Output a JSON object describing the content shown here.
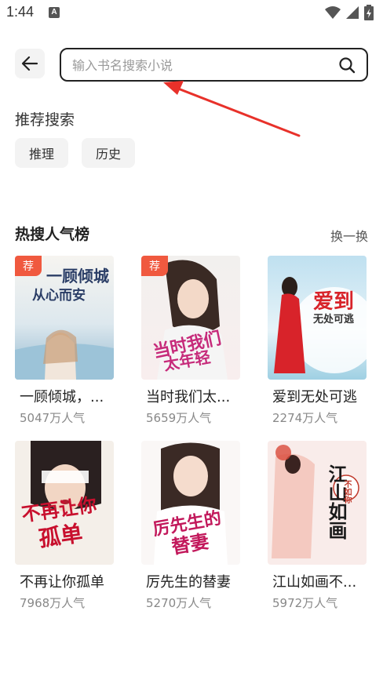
{
  "status": {
    "time": "1:44",
    "notif": "A"
  },
  "search": {
    "placeholder": "输入书名搜索小说"
  },
  "recommended": {
    "title": "推荐搜索",
    "tags": [
      "推理",
      "历史"
    ]
  },
  "hot": {
    "title": "热搜人气榜",
    "refresh_label": "换一换",
    "books": [
      {
        "title": "一顾倾城，...",
        "popularity": "5047万人气",
        "badge": "荐",
        "cover_title": "一顾倾城",
        "cover_sub": "从心而安"
      },
      {
        "title": "当时我们太...",
        "popularity": "5659万人气",
        "badge": "荐",
        "cover_title": "当时我们",
        "cover_sub": "太年轻"
      },
      {
        "title": "爱到无处可逃",
        "popularity": "2274万人气",
        "badge": "",
        "cover_title": "爱到",
        "cover_sub": "无处可逃"
      },
      {
        "title": "不再让你孤单",
        "popularity": "7968万人气",
        "badge": "",
        "cover_title": "不再让你",
        "cover_sub": "孤单"
      },
      {
        "title": "厉先生的替妻",
        "popularity": "5270万人气",
        "badge": "",
        "cover_title": "厉先生的",
        "cover_sub": "替妻"
      },
      {
        "title": "江山如画不...",
        "popularity": "5972万人气",
        "badge": "",
        "cover_title": "江山如画",
        "cover_sub": "不如你"
      }
    ]
  },
  "colors": {
    "accent": "#f0593f",
    "tag_bg": "#f3f3f3"
  }
}
